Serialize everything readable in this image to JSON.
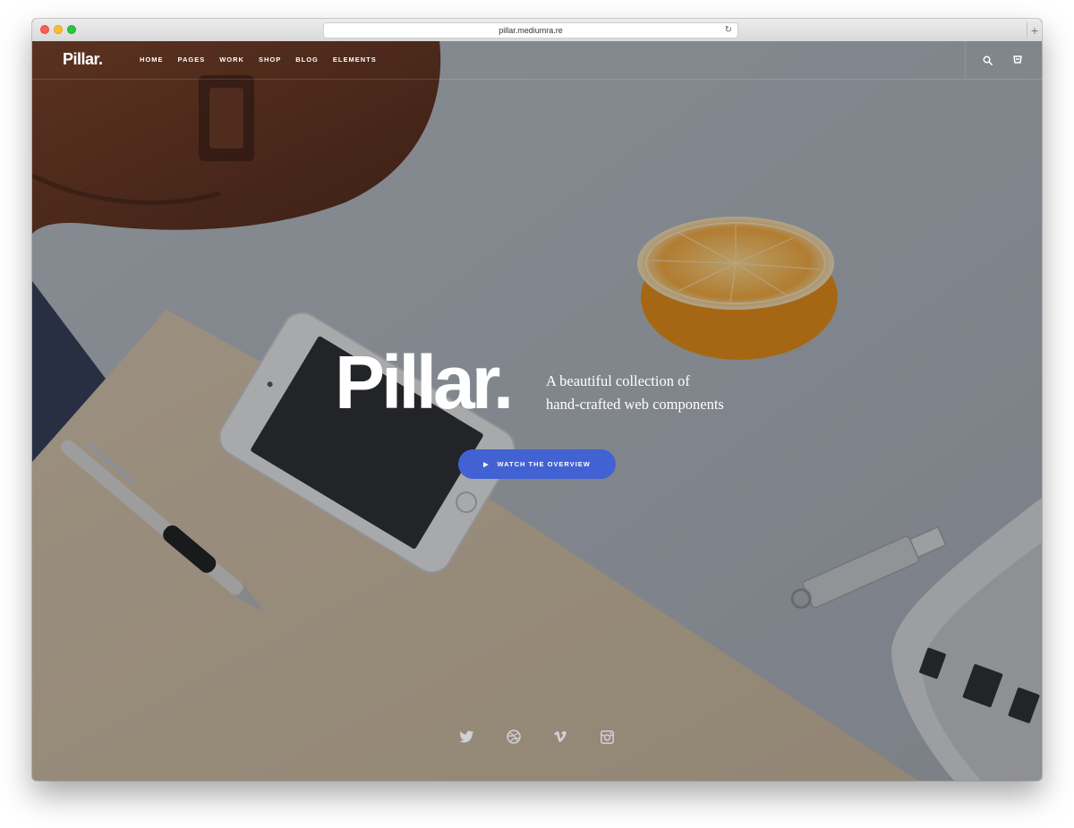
{
  "browser": {
    "url": "pillar.mediumra.re",
    "reload_icon": "reload-icon",
    "new_tab_icon": "plus-icon",
    "new_tab_label": "+"
  },
  "nav": {
    "logo": "Pillar.",
    "items": [
      {
        "label": "HOME"
      },
      {
        "label": "PAGES"
      },
      {
        "label": "WORK"
      },
      {
        "label": "SHOP"
      },
      {
        "label": "BLOG"
      },
      {
        "label": "ELEMENTS"
      }
    ],
    "icons": [
      "search-icon",
      "cart-icon"
    ]
  },
  "hero": {
    "title": "Pillar.",
    "subtitle_line1": "A beautiful collection of",
    "subtitle_line2": "hand-crafted web components",
    "cta_label": "WATCH THE OVERVIEW",
    "cta_icon": "play-icon",
    "accent_color": "#4262d3"
  },
  "social": {
    "icons": [
      "twitter-icon",
      "dribbble-icon",
      "vimeo-icon",
      "instagram-icon"
    ]
  }
}
